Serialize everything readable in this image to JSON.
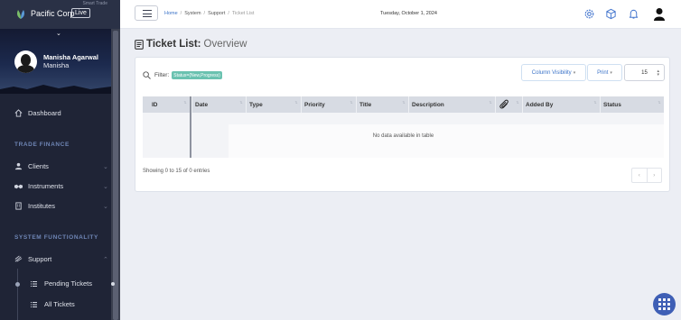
{
  "sidebar": {
    "tagline": "Smart Trade",
    "brand": "Pacific Corp",
    "env_badge": "Live",
    "user": {
      "name": "Manisha Agarwal",
      "subtitle": "Manisha"
    },
    "dashboard_label": "Dashboard",
    "section_trade_finance": "TRADE FINANCE",
    "items": [
      {
        "label": "Clients",
        "icon": "users-icon"
      },
      {
        "label": "Instruments",
        "icon": "handshake-icon"
      },
      {
        "label": "Institutes",
        "icon": "building-icon"
      }
    ],
    "section_system": "SYSTEM FUNCTIONALITY",
    "support_label": "Support",
    "sub_items": [
      {
        "label": "Pending Tickets"
      },
      {
        "label": "All Tickets"
      }
    ]
  },
  "header": {
    "breadcrumbs": [
      "Home",
      "System",
      "Support",
      "Ticket List"
    ],
    "separator": "/",
    "date": "Tuesday, October 1, 2024",
    "icons": [
      "settings-icon",
      "cube-icon",
      "bell-icon",
      "user-icon"
    ]
  },
  "page": {
    "title_bold": "Ticket List:",
    "title_light": "Overview"
  },
  "toolbar": {
    "filter_label": "Filter:",
    "filter_chip": "Status=(New,Progress)",
    "column_visibility": "Column Visibility",
    "print": "Print",
    "page_size": "15"
  },
  "table": {
    "columns": [
      "ID",
      "Date",
      "Type",
      "Priority",
      "Title",
      "Description",
      "",
      "Added By",
      "Status"
    ],
    "empty_message": "No data available in table",
    "info": "Showing 0 to 15 of 0 entries",
    "pager_prev": "‹",
    "pager_next": "›"
  },
  "colors": {
    "sidebar_bg": "#1f2436",
    "accent": "#3b73c8",
    "filter_chip": "#6ac2b0",
    "fab": "#3f5fb5"
  }
}
